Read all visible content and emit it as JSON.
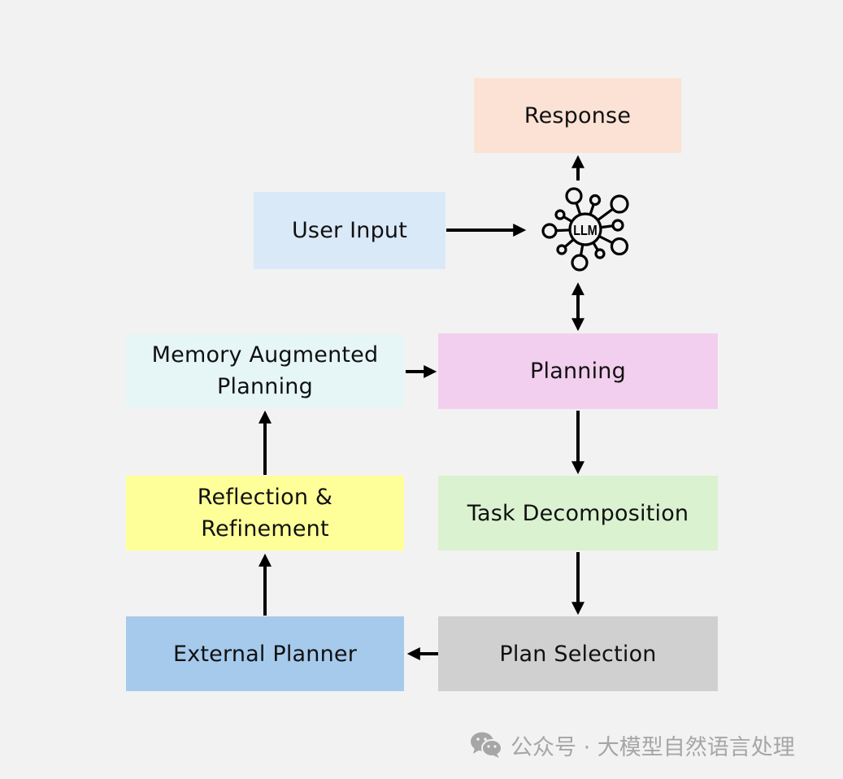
{
  "diagram": {
    "nodes": {
      "response": {
        "label": "Response",
        "color": "#fbe2d5"
      },
      "user_input": {
        "label": "User Input",
        "color": "#dae9f7"
      },
      "llm": {
        "label": "LLM"
      },
      "memory_augmented_planning": {
        "label": "Memory Augmented\nPlanning",
        "color": "#e6f6f6"
      },
      "planning": {
        "label": "Planning",
        "color": "#f2cfee"
      },
      "reflection_refinement": {
        "label": "Reflection &\nRefinement",
        "color": "#ffff99"
      },
      "task_decomposition": {
        "label": "Task Decomposition",
        "color": "#daf2d0"
      },
      "external_planner": {
        "label": "External Planner",
        "color": "#a6caec"
      },
      "plan_selection": {
        "label": "Plan Selection",
        "color": "#d0d0d0"
      }
    },
    "edges": [
      {
        "from": "user_input",
        "to": "llm",
        "type": "one-way"
      },
      {
        "from": "llm",
        "to": "response",
        "type": "one-way"
      },
      {
        "from": "llm",
        "to": "planning",
        "type": "two-way"
      },
      {
        "from": "memory_augmented_planning",
        "to": "planning",
        "type": "one-way"
      },
      {
        "from": "planning",
        "to": "task_decomposition",
        "type": "one-way"
      },
      {
        "from": "task_decomposition",
        "to": "plan_selection",
        "type": "one-way"
      },
      {
        "from": "plan_selection",
        "to": "external_planner",
        "type": "one-way"
      },
      {
        "from": "external_planner",
        "to": "reflection_refinement",
        "type": "one-way"
      },
      {
        "from": "reflection_refinement",
        "to": "memory_augmented_planning",
        "type": "one-way"
      }
    ]
  },
  "watermark": {
    "icon": "wechat-icon",
    "text": "公众号 · 大模型自然语言处理"
  }
}
